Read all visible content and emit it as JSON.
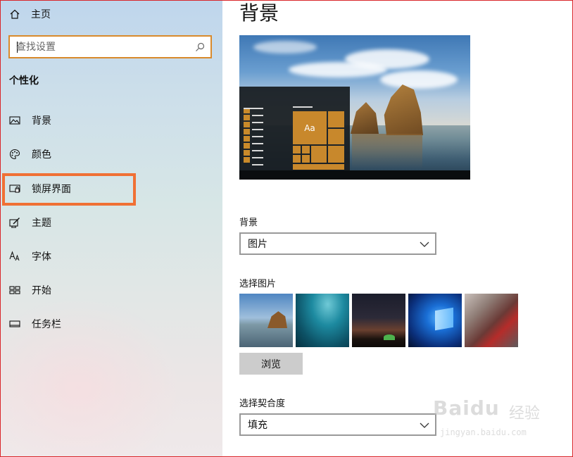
{
  "sidebar": {
    "home_label": "主页",
    "search_placeholder": "查找设置",
    "section_title": "个性化",
    "items": [
      {
        "label": "背景",
        "icon": "image-icon"
      },
      {
        "label": "颜色",
        "icon": "palette-icon"
      },
      {
        "label": "锁屏界面",
        "icon": "lock-screen-icon"
      },
      {
        "label": "主题",
        "icon": "theme-icon"
      },
      {
        "label": "字体",
        "icon": "font-icon"
      },
      {
        "label": "开始",
        "icon": "start-icon"
      },
      {
        "label": "任务栏",
        "icon": "taskbar-icon"
      }
    ]
  },
  "main": {
    "title": "背景",
    "preview_tile_text": "Aa",
    "background_label": "背景",
    "background_value": "图片",
    "choose_picture_label": "选择图片",
    "browse_label": "浏览",
    "fit_label": "选择契合度",
    "fit_value": "填充"
  },
  "watermark": {
    "logo": "Baidu",
    "cn": "经验",
    "url": "jingyan.baidu.com"
  },
  "colors": {
    "highlight": "#f07034",
    "search_border": "#d98a2b",
    "tile": "#c8882c"
  }
}
